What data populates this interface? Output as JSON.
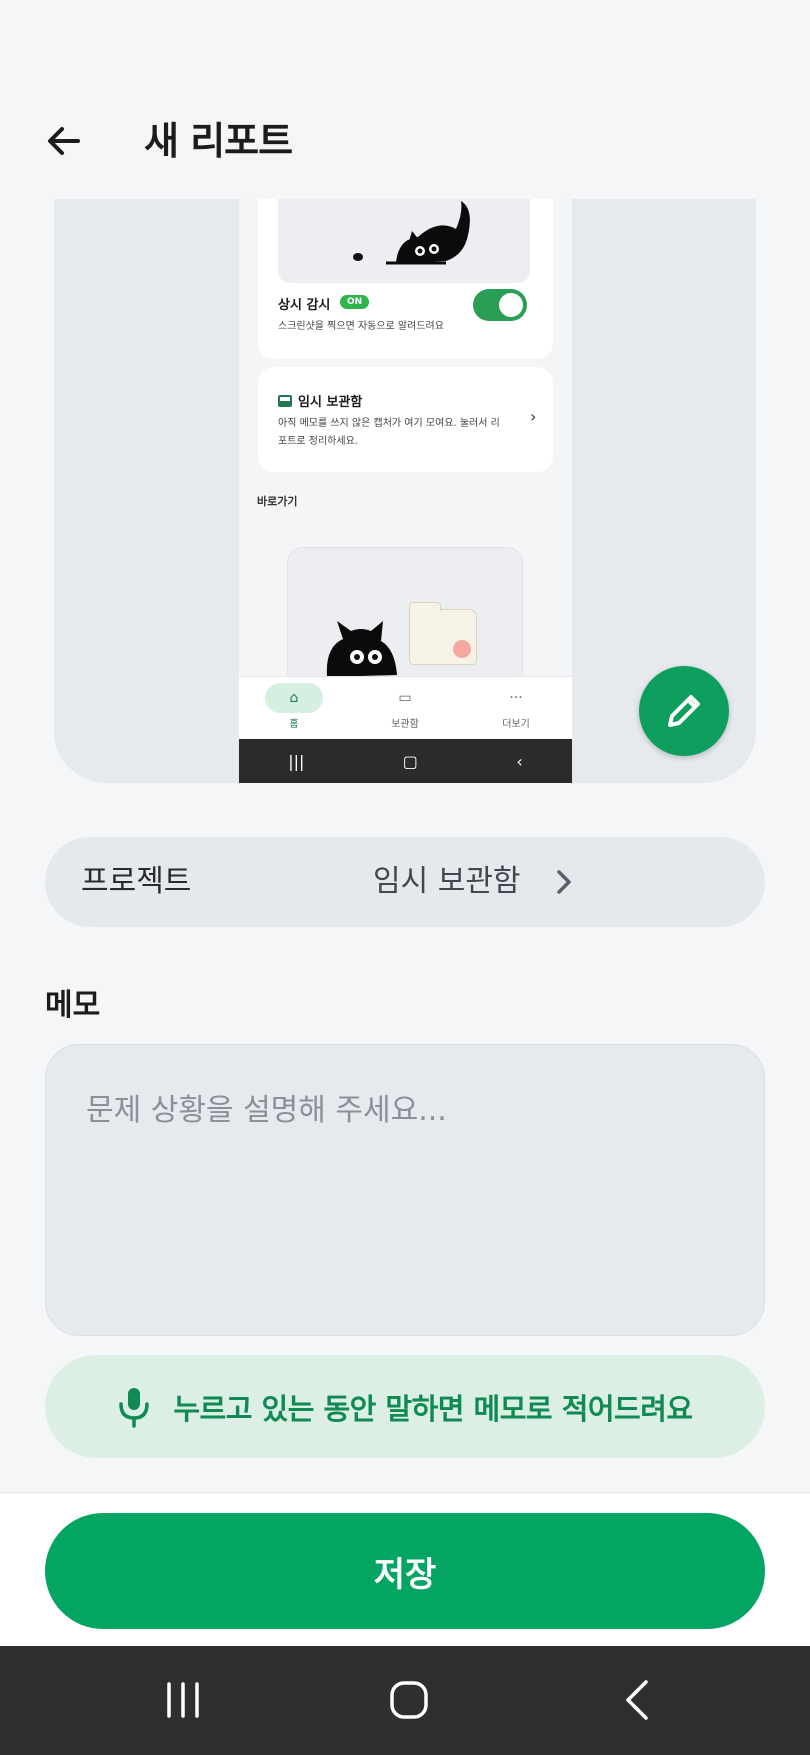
{
  "header": {
    "title": "새 리포트"
  },
  "preview": {
    "watch_title": "상시 감시",
    "on_badge": "ON",
    "watch_subtitle": "스크린샷을 찍으면 자동으로 알려드려요",
    "inbox_title": "임시 보관함",
    "inbox_desc": "아직 메모를 쓰지 않은 캡처가 여기 모여요. 눌러서 리포트로 정리하세요.",
    "shortcut_label": "바로가기",
    "nav": [
      {
        "label": "홈",
        "icon": "home-icon"
      },
      {
        "label": "보관함",
        "icon": "archive-icon"
      },
      {
        "label": "더보기",
        "icon": "more-icon"
      }
    ]
  },
  "project": {
    "label": "프로젝트",
    "value": "임시 보관함"
  },
  "memo": {
    "label": "메모",
    "placeholder": "문제 상황을 설명해 주세요..."
  },
  "voice": {
    "label": "누르고 있는 동안 말하면 메모로 적어드려요"
  },
  "save": {
    "label": "저장"
  },
  "colors": {
    "accent": "#04a563",
    "accent_light": "#dcefe5",
    "background": "#f5f6f8"
  }
}
